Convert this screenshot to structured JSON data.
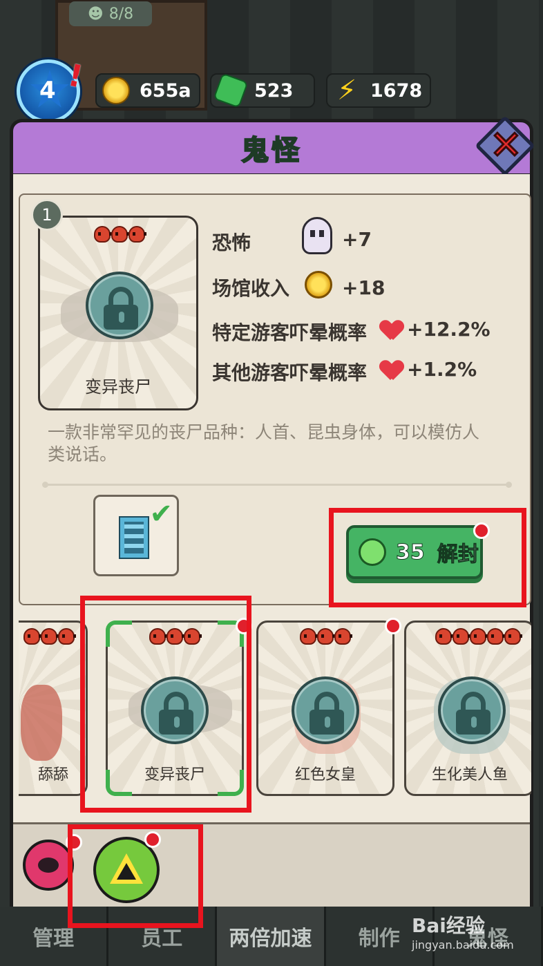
{
  "hud": {
    "level": "4",
    "coins": "655a",
    "gems": "523",
    "energy": "1678",
    "top_counter": "8/8"
  },
  "panel": {
    "title": "鬼怪",
    "selected": {
      "slot_number": "1",
      "name": "变异丧尸",
      "skull_count": 3,
      "locked": true,
      "stats": [
        {
          "label": "恐怖",
          "icon": "ghost-icon",
          "value": "+7"
        },
        {
          "label": "场馆收入",
          "icon": "coin-icon",
          "value": "+18"
        },
        {
          "label": "特定游客吓晕概率",
          "icon": "heart-pulse-icon",
          "value": "+12.2%"
        },
        {
          "label": "其他游客吓晕概率",
          "icon": "heart-pulse-icon",
          "value": "+1.2%"
        }
      ],
      "description": "一款非常罕见的丧尸品种：人首、昆虫身体，可以模仿人类说话。",
      "requirement_icon": "building-check-icon",
      "unlock_cost": "35",
      "unlock_label": "解封"
    },
    "cards": [
      {
        "name": "舔舔",
        "skull_count": 3,
        "locked": false
      },
      {
        "name": "变异丧尸",
        "skull_count": 3,
        "locked": true,
        "selected": true
      },
      {
        "name": "红色女皇",
        "skull_count": 3,
        "locked": true
      },
      {
        "name": "生化美人鱼",
        "skull_count": 5,
        "locked": true
      }
    ],
    "tabs": [
      {
        "icon": "eye-monster-icon"
      },
      {
        "icon": "radiation-icon",
        "active": true
      }
    ]
  },
  "bottom_nav": [
    "管理",
    "员工",
    "两倍加速",
    "制作",
    "鬼怪"
  ],
  "watermark": {
    "top": "Bai经验",
    "bottom": "jingyan.baidu.com"
  },
  "colors": {
    "header": "#b47ad6",
    "title": "#5fe07e",
    "unlock": "#45b464",
    "annotation": "#e8141e"
  }
}
